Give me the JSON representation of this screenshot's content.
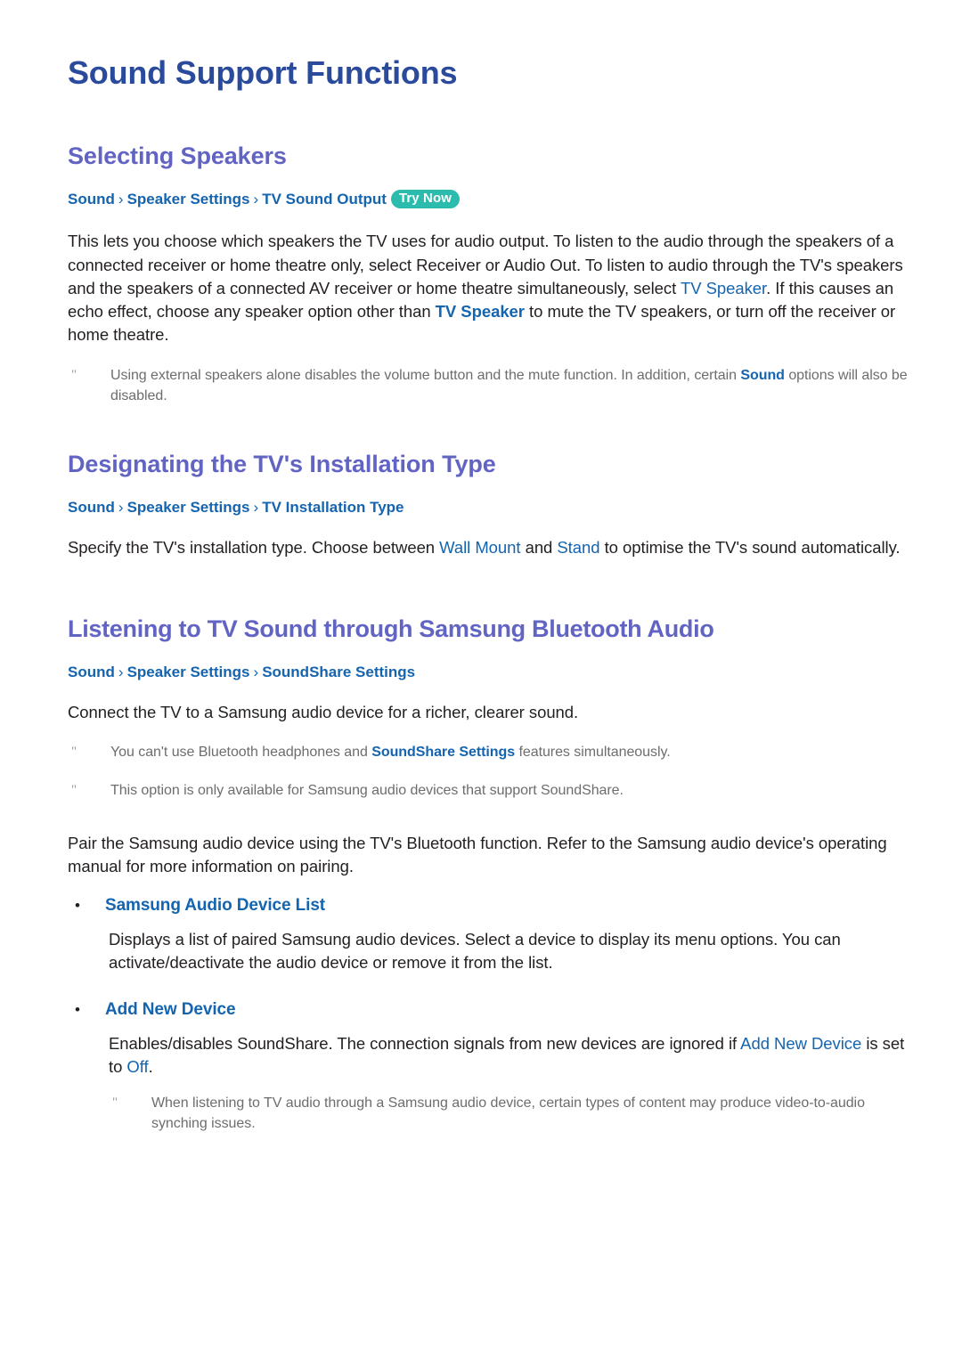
{
  "document": {
    "title": "Sound Support Functions"
  },
  "sections": [
    {
      "heading": "Selecting Speakers",
      "breadcrumb": {
        "items": [
          "Sound",
          "Speaker Settings",
          "TV Sound Output"
        ],
        "separator": "›",
        "badge": "Try Now"
      },
      "paragraph_parts": [
        {
          "text": "This lets you choose which speakers the TV uses for audio output. To listen to the audio through the speakers of a connected receiver or home theatre only, select Receiver or Audio Out. To listen to audio through the TV's speakers and the speakers of a connected AV receiver or home theatre simultaneously, select ",
          "style": "plain"
        },
        {
          "text": "TV Speaker",
          "style": "keyword"
        },
        {
          "text": ". If this causes an echo effect, choose any speaker option other than ",
          "style": "plain"
        },
        {
          "text": "TV Speaker",
          "style": "keyword-bold"
        },
        {
          "text": " to mute the TV speakers, or turn off the receiver or home theatre.",
          "style": "plain"
        }
      ],
      "notes": [
        {
          "mark": "\"",
          "parts": [
            {
              "text": "Using external speakers alone disables the volume button and the mute function. In addition, certain ",
              "style": "plain"
            },
            {
              "text": "Sound",
              "style": "keyword-bold"
            },
            {
              "text": " options will also be disabled.",
              "style": "plain"
            }
          ]
        }
      ]
    },
    {
      "heading": "Designating the TV's Installation Type",
      "breadcrumb": {
        "items": [
          "Sound",
          "Speaker Settings",
          "TV Installation Type"
        ],
        "separator": "›",
        "badge": ""
      },
      "paragraph_parts": [
        {
          "text": "Specify the TV's installation type. Choose between ",
          "style": "plain"
        },
        {
          "text": "Wall Mount",
          "style": "keyword"
        },
        {
          "text": " and ",
          "style": "plain"
        },
        {
          "text": "Stand",
          "style": "keyword"
        },
        {
          "text": " to optimise the TV's sound automatically.",
          "style": "plain"
        }
      ],
      "notes": []
    },
    {
      "heading": "Listening to TV Sound through Samsung Bluetooth Audio",
      "breadcrumb": {
        "items": [
          "Sound",
          "Speaker Settings",
          "SoundShare Settings"
        ],
        "separator": "›",
        "badge": ""
      },
      "paragraph_parts": [
        {
          "text": "Connect the TV to a Samsung audio device for a richer, clearer sound.",
          "style": "plain"
        }
      ],
      "notes": [
        {
          "mark": "\"",
          "parts": [
            {
              "text": "You can't use Bluetooth headphones and ",
              "style": "plain"
            },
            {
              "text": "SoundShare Settings",
              "style": "keyword-bold"
            },
            {
              "text": " features simultaneously.",
              "style": "plain"
            }
          ]
        },
        {
          "mark": "\"",
          "parts": [
            {
              "text": "This option is only available for Samsung audio devices that support SoundShare.",
              "style": "plain"
            }
          ]
        }
      ],
      "after_paragraph_parts": [
        {
          "text": "Pair the Samsung audio device using the TV's Bluetooth function. Refer to the Samsung audio device's operating manual for more information on pairing.",
          "style": "plain"
        }
      ],
      "bullets": [
        {
          "marker": "•",
          "label": "Samsung Audio Device List",
          "body_parts": [
            {
              "text": "Displays a list of paired Samsung audio devices. Select a device to display its menu options. You can activate/deactivate the audio device or remove it from the list.",
              "style": "plain"
            }
          ],
          "notes": []
        },
        {
          "marker": "•",
          "label": "Add New Device",
          "body_parts": [
            {
              "text": "Enables/disables SoundShare. The connection signals from new devices are ignored if ",
              "style": "plain"
            },
            {
              "text": "Add New Device",
              "style": "keyword"
            },
            {
              "text": " is set to ",
              "style": "plain"
            },
            {
              "text": "Off",
              "style": "keyword"
            },
            {
              "text": ".",
              "style": "plain"
            }
          ],
          "notes": [
            {
              "mark": "\"",
              "parts": [
                {
                  "text": "When listening to TV audio through a Samsung audio device, certain types of content may produce video-to-audio synching issues.",
                  "style": "plain"
                }
              ]
            }
          ]
        }
      ]
    }
  ],
  "colors": {
    "doc_title": "#2a4a9b",
    "section_heading": "#6264c4",
    "breadcrumb_link": "#1464af",
    "keyword": "#1464af",
    "badge_background": "#2bbcae",
    "badge_text": "#ffffff",
    "body_text": "#231f20",
    "note_text": "#6d6d6d"
  }
}
